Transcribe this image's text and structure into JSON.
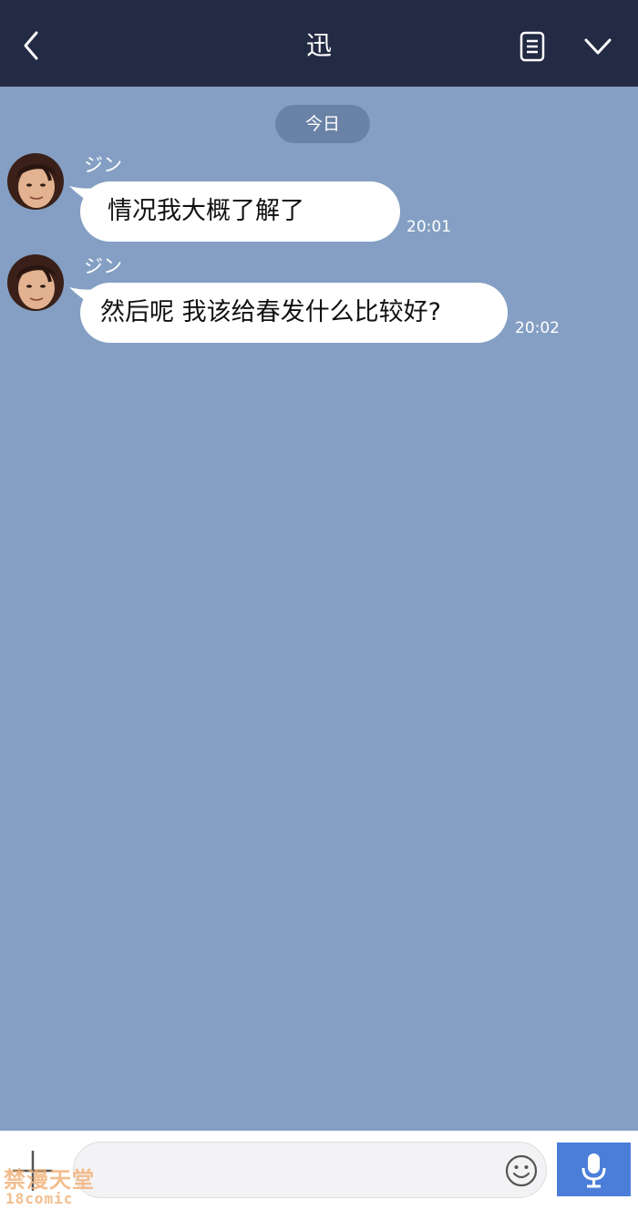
{
  "header": {
    "title": "迅",
    "back_icon": "chevron-left-icon",
    "notes_icon": "notes-icon",
    "more_icon": "chevron-down-icon"
  },
  "chat": {
    "date_label": "今日",
    "messages": [
      {
        "sender": "ジン",
        "text": "情况我大概了解了",
        "time": "20:01"
      },
      {
        "sender": "ジン",
        "text": "然后呢 我该给春发什么比较好?",
        "time": "20:02"
      }
    ]
  },
  "input": {
    "placeholder": "",
    "plus_icon": "plus-icon",
    "emoji_icon": "smiley-icon",
    "mic_icon": "microphone-icon"
  },
  "watermark": {
    "line1": "禁漫天堂",
    "line2": "18comic"
  },
  "colors": {
    "header_bg": "#232a43",
    "chat_bg": "#849fc3",
    "date_chip_bg": "#6a82a6",
    "bubble_bg": "#ffffff",
    "mic_button_bg": "#4b7ed8",
    "watermark": "#f2b27a"
  }
}
